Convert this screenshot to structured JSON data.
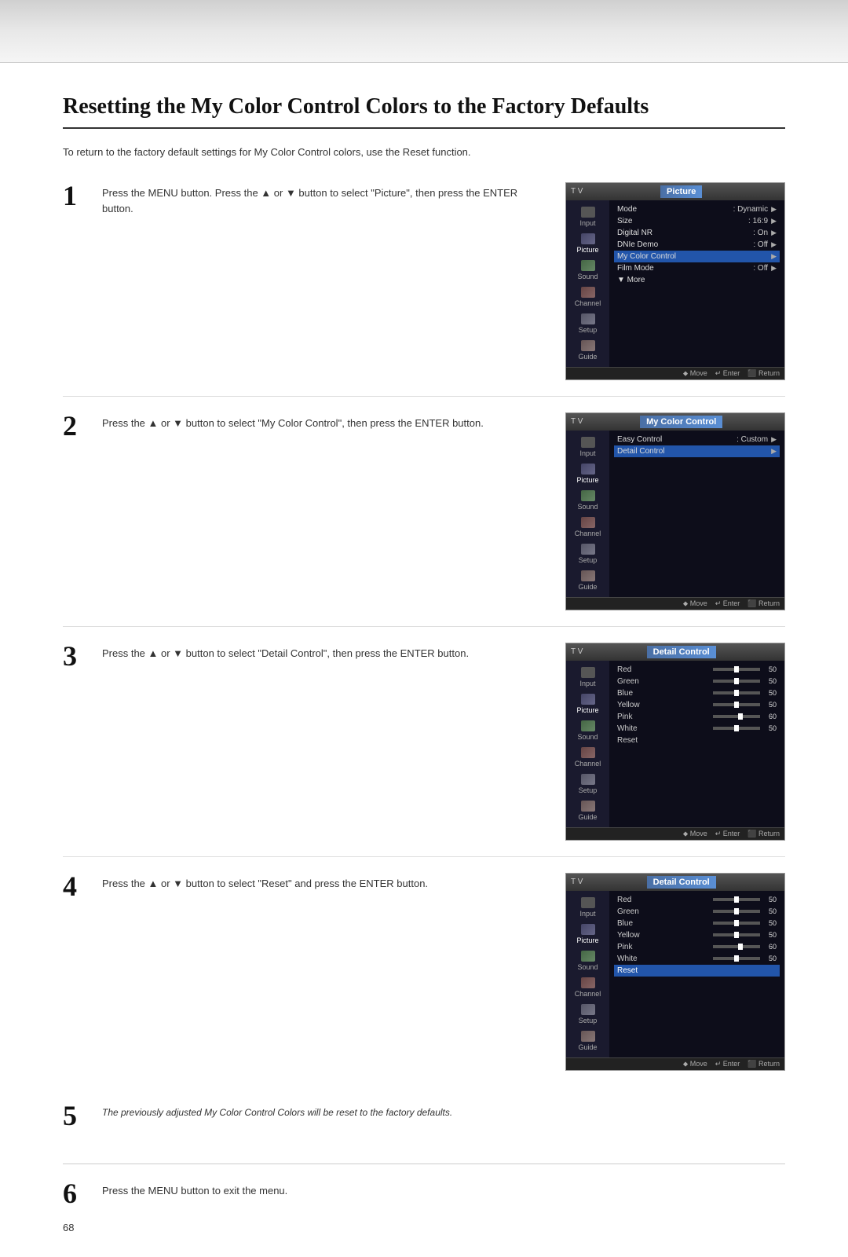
{
  "header": {
    "gradient": true
  },
  "page": {
    "title": "Resetting the My Color Control Colors to the Factory Defaults",
    "intro": "To return to the factory default settings for My Color Control colors, use the Reset function.",
    "page_number": "68"
  },
  "steps": [
    {
      "number": "1",
      "text": "Press the MENU button. Press the ▲ or ▼ button to select \"Picture\", then press the ENTER button.",
      "screen": {
        "tv_label": "T V",
        "menu_title": "Picture",
        "rows": [
          {
            "label": "Mode",
            "value": ": Dynamic",
            "arrow": true
          },
          {
            "label": "Size",
            "value": ": 16:9",
            "arrow": true
          },
          {
            "label": "Digital NR",
            "value": ": On",
            "arrow": true
          },
          {
            "label": "DNIe Demo",
            "value": ": Off",
            "arrow": true
          },
          {
            "label": "My Color Control",
            "value": "",
            "arrow": true
          },
          {
            "label": "Film Mode",
            "value": ": Off",
            "arrow": true
          },
          {
            "label": "▼ More",
            "value": "",
            "arrow": false
          }
        ]
      }
    },
    {
      "number": "2",
      "text": "Press the ▲ or ▼ button to select \"My Color Control\", then press the ENTER button.",
      "screen": {
        "tv_label": "T V",
        "menu_title": "My Color Control",
        "rows": [
          {
            "label": "Easy Control",
            "value": ": Custom",
            "arrow": true
          },
          {
            "label": "Detail Control",
            "value": "",
            "arrow": true
          }
        ]
      }
    },
    {
      "number": "3",
      "text": "Press the ▲ or ▼ button to select \"Detail Control\", then press the ENTER button.",
      "screen": {
        "tv_label": "T V",
        "menu_title": "Detail Control",
        "rows": [
          {
            "label": "Red",
            "value": "50",
            "slider": true
          },
          {
            "label": "Green",
            "value": "50",
            "slider": true
          },
          {
            "label": "Blue",
            "value": "50",
            "slider": true
          },
          {
            "label": "Yellow",
            "value": "50",
            "slider": true
          },
          {
            "label": "Pink",
            "value": "60",
            "slider": true
          },
          {
            "label": "White",
            "value": "50",
            "slider": true
          },
          {
            "label": "Reset",
            "value": "",
            "slider": false
          }
        ]
      }
    },
    {
      "number": "4",
      "text": "Press the ▲ or ▼ button to select \"Reset\" and press the ENTER button.",
      "screen": {
        "tv_label": "T V",
        "menu_title": "Detail Control",
        "rows": [
          {
            "label": "Red",
            "value": "50",
            "slider": true
          },
          {
            "label": "Green",
            "value": "50",
            "slider": true
          },
          {
            "label": "Blue",
            "value": "50",
            "slider": true
          },
          {
            "label": "Yellow",
            "value": "50",
            "slider": true
          },
          {
            "label": "Pink",
            "value": "60",
            "slider": true
          },
          {
            "label": "White",
            "value": "50",
            "slider": true
          },
          {
            "label": "Reset",
            "value": "",
            "slider": false,
            "selected": true
          }
        ]
      }
    }
  ],
  "step5": {
    "number": "5",
    "text": "The previously adjusted My Color Control Colors will be reset to the factory defaults."
  },
  "step6": {
    "number": "6",
    "text": "Press the MENU button to exit the menu."
  },
  "sidebar_items": [
    {
      "label": "Input",
      "type": "input"
    },
    {
      "label": "Picture",
      "type": "picture"
    },
    {
      "label": "Sound",
      "type": "sound"
    },
    {
      "label": "Channel",
      "type": "channel"
    },
    {
      "label": "Setup",
      "type": "setup"
    },
    {
      "label": "Guide",
      "type": "guide"
    }
  ],
  "footer_items": [
    "⬥ Move",
    "↵ Enter",
    "⬛ Return"
  ]
}
